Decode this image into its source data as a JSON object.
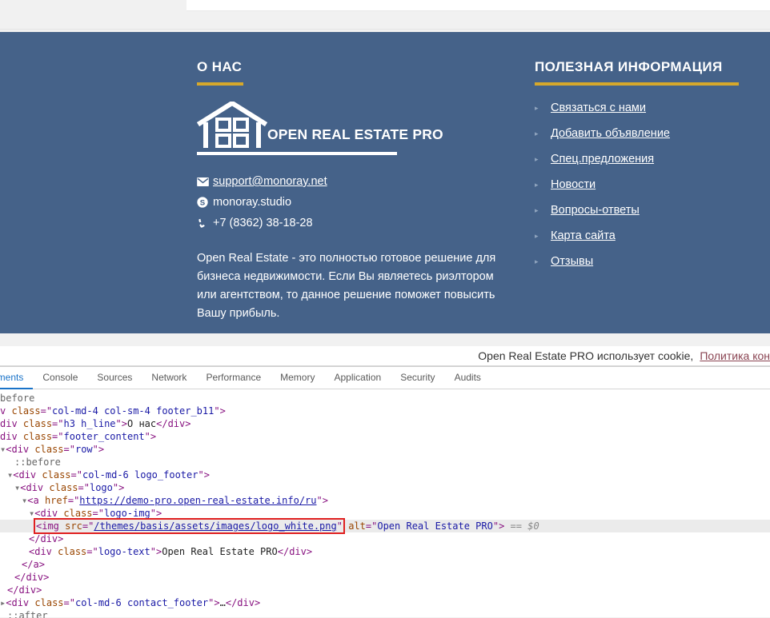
{
  "page": {
    "footer_bg": "#456289",
    "accent_gold": "#d6a82b"
  },
  "footer": {
    "about": {
      "heading": "О НАС",
      "logo_text": "OPEN REAL ESTATE PRO",
      "logo_icon": "house-icon",
      "contacts": [
        {
          "icon": "envelope-icon",
          "text": "support@monoray.net",
          "is_link": true
        },
        {
          "icon": "skype-icon",
          "text": "monoray.studio",
          "is_link": false
        },
        {
          "icon": "phone-icon",
          "text": "+7 (8362) 38-18-28",
          "is_link": false
        }
      ],
      "description": "Open Real Estate - это полностью готовое решение для бизнеса недвижимости. Если Вы являетесь риэлтором или агентством, то данное решение поможет повысить Вашу прибыль."
    },
    "info": {
      "heading": "ПОЛЕЗНАЯ ИНФОРМАЦИЯ",
      "links": [
        "Связаться с нами",
        "Добавить объявление",
        "Спец.предложения",
        "Новости",
        "Вопросы-ответы",
        "Карта сайта",
        "Отзывы"
      ]
    }
  },
  "cookie_bar": {
    "text": "Open Real Estate PRO использует cookie,",
    "link": "Политика кон"
  },
  "devtools": {
    "tabs": [
      {
        "label": "ements",
        "active": true
      },
      {
        "label": "Console",
        "active": false
      },
      {
        "label": "Sources",
        "active": false
      },
      {
        "label": "Network",
        "active": false
      },
      {
        "label": "Performance",
        "active": false
      },
      {
        "label": "Memory",
        "active": false
      },
      {
        "label": "Application",
        "active": false
      },
      {
        "label": "Security",
        "active": false
      },
      {
        "label": "Audits",
        "active": false
      }
    ],
    "dom_rows": [
      {
        "id": "r0",
        "indent": 0,
        "raw": "before",
        "kind": "pseudo-clipped"
      },
      {
        "id": "r1",
        "indent": 0,
        "raw": "v class=\"col-md-4 col-sm-4 footer_b11\">",
        "kind": "clipped-open"
      },
      {
        "id": "r2",
        "indent": 0,
        "raw": "div class=\"h3 h_line\">О нас</div>",
        "kind": "clipped-line"
      },
      {
        "id": "r3",
        "indent": 0,
        "raw": "div class=\"footer_content\">",
        "kind": "clipped-open2"
      },
      {
        "id": "r4",
        "indent": 0,
        "raw": "<div class=\"row\">",
        "kind": "open-tri"
      },
      {
        "id": "r5",
        "indent": 2,
        "raw": "::before",
        "kind": "pseudo"
      },
      {
        "id": "r6",
        "indent": 1,
        "raw": "<div class=\"col-md-6 logo_footer\">",
        "kind": "open-tri"
      },
      {
        "id": "r7",
        "indent": 2,
        "raw": "<div class=\"logo\">",
        "kind": "open-tri"
      },
      {
        "id": "r8",
        "indent": 3,
        "raw": "<a href=\"https://demo-pro.open-real-estate.info/ru\">",
        "kind": "anchor-tri"
      },
      {
        "id": "r9",
        "indent": 4,
        "raw": "<div class=\"logo-img\">",
        "kind": "open-tri"
      },
      {
        "id": "r10",
        "indent": 5,
        "raw": "<img src=\"/themes/basis/assets/images/logo_white.png\" alt=\"Open Real Estate PRO\"> == $0",
        "kind": "img-selected"
      },
      {
        "id": "r11",
        "indent": 4,
        "raw": "</div>",
        "kind": "close"
      },
      {
        "id": "r12",
        "indent": 4,
        "raw": "<div class=\"logo-text\">Open Real Estate PRO</div>",
        "kind": "logo-text-line"
      },
      {
        "id": "r13",
        "indent": 3,
        "raw": "</a>",
        "kind": "close"
      },
      {
        "id": "r14",
        "indent": 2,
        "raw": "</div>",
        "kind": "close"
      },
      {
        "id": "r15",
        "indent": 1,
        "raw": "</div>",
        "kind": "close"
      },
      {
        "id": "r16",
        "indent": 0,
        "raw": "<div class=\"col-md-6 contact_footer\">…</div>",
        "kind": "collapsed-tri"
      },
      {
        "id": "r17",
        "indent": 1,
        "raw": "::after",
        "kind": "pseudo"
      }
    ],
    "selected_img": {
      "src": "/themes/basis/assets/images/logo_white.png",
      "alt": "Open Real Estate PRO",
      "console_ref": "== $0"
    },
    "dom_text": {
      "onas": "О нас",
      "logo_text": "Open Real Estate PRO",
      "anchor_href": "https://demo-pro.open-real-estate.info/ru"
    }
  }
}
